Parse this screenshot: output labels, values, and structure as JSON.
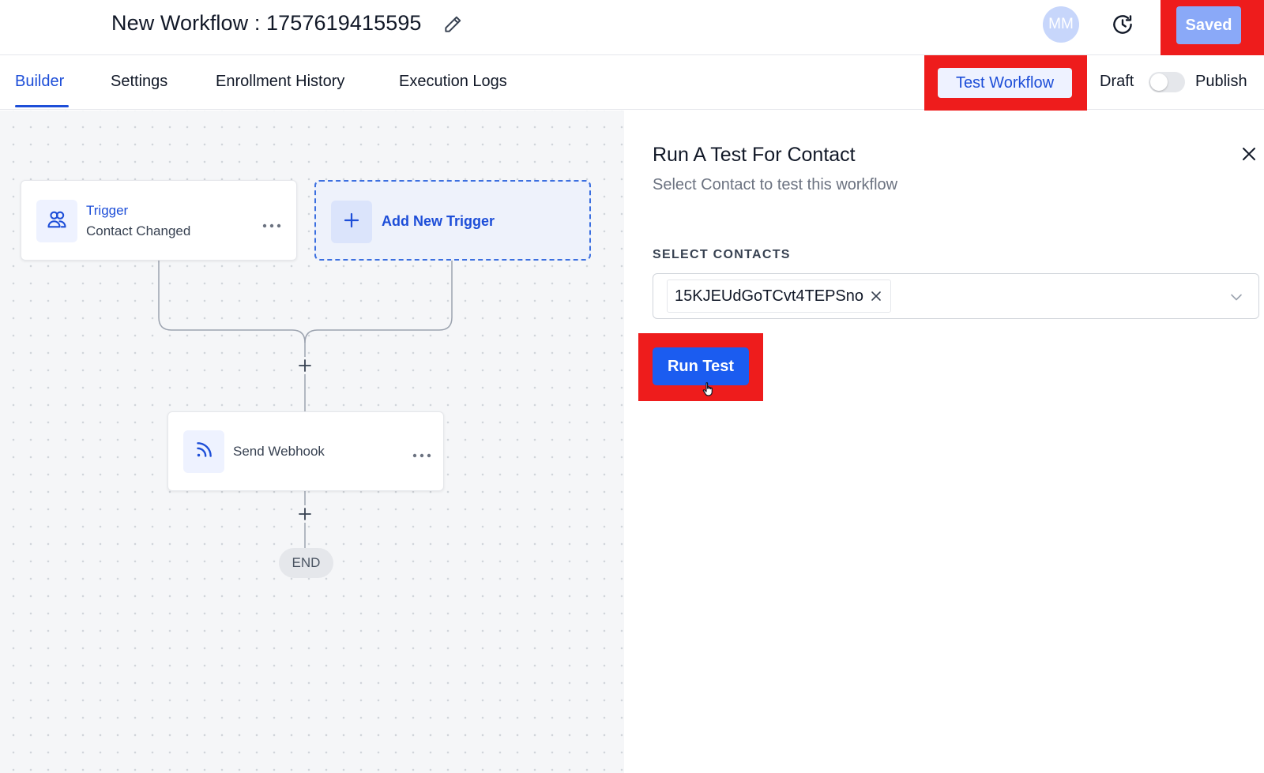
{
  "header": {
    "workflow_title": "New Workflow : 1757619415595",
    "avatar_initials": "MM",
    "saved_label": "Saved"
  },
  "tabs": [
    {
      "label": "Builder",
      "active": true
    },
    {
      "label": "Settings",
      "active": false
    },
    {
      "label": "Enrollment History",
      "active": false
    },
    {
      "label": "Execution Logs",
      "active": false
    }
  ],
  "toolbar": {
    "test_workflow_label": "Test Workflow",
    "draft_label": "Draft",
    "publish_label": "Publish",
    "published": false
  },
  "canvas": {
    "trigger": {
      "label": "Trigger",
      "event": "Contact Changed"
    },
    "add_trigger_label": "Add New Trigger",
    "actions": [
      {
        "label": "Send Webhook"
      }
    ],
    "end_label": "END"
  },
  "panel": {
    "title": "Run A Test For Contact",
    "subtitle": "Select Contact to test this workflow",
    "select_label": "SELECT CONTACTS",
    "selected_contacts": [
      "15KJEUdGoTCvt4TEPSno"
    ],
    "run_label": "Run Test"
  },
  "colors": {
    "accent": "#1d4ed8",
    "primary_button": "#1b5cf0",
    "highlight": "#ee1c1c",
    "saved_button": "#8aa9f8"
  },
  "icons": [
    "pencil-icon",
    "history-icon",
    "users-icon",
    "plus-icon",
    "webhook-icon",
    "more-icon",
    "close-icon",
    "chevron-down-icon"
  ]
}
